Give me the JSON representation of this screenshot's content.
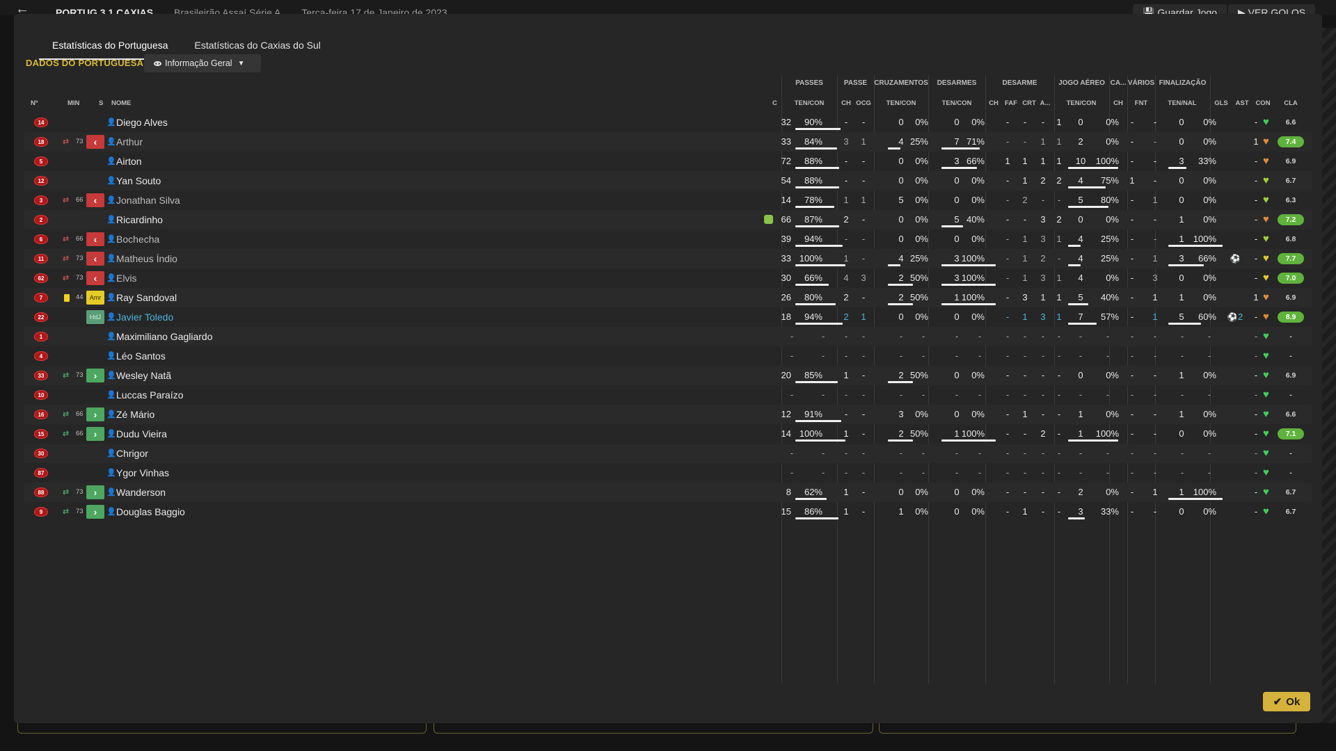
{
  "background": {
    "match_title": "PORTUG 3 1 CAXIAS",
    "competition": "Brasileirão Assaí Série A",
    "date": "Terça-feira 17 de Janeiro de 2023",
    "save_label": "Guardar Jogo",
    "goals_label": "VER GOLOS"
  },
  "tabs": [
    "Estatísticas do Portuguesa",
    "Estatísticas do Caxias do Sul"
  ],
  "section_label": "DADOS DO PORTUGUESA",
  "view_dropdown": "Informação Geral",
  "group_headers": {
    "passes": "PASSES",
    "passe": "PASSE",
    "cruzamentos": "CRUZAMENTOS",
    "desarmes": "DESARMES",
    "desarme": "DESARME",
    "jogo_aereo": "JOGO AÉREO",
    "ca": "CA...",
    "varios": "VÁRIOS",
    "finalizacao": "FINALIZAÇÃO"
  },
  "columns": {
    "num": "Nº",
    "min": "MIN",
    "s": "S",
    "nome": "NOME",
    "c": "C",
    "passes_tc": "TEN/CON",
    "passe_ch": "CH",
    "passe_ocg": "OCG",
    "cruz_tc": "TEN/CON",
    "desarmes_tc": "TEN/CON",
    "desarme_ch": "CH",
    "desarme_faf": "FAF",
    "desarme_crt": "CRT",
    "desarme_a": "A...",
    "aereo_tc": "TEN/CON",
    "ca_ch": "CH",
    "fnt": "FNT",
    "fin_tn": "TEN/NAL",
    "gls": "GLS",
    "ast": "AST",
    "con": "CON",
    "cla": "CLA"
  },
  "players": [
    {
      "num": "14",
      "min": "",
      "s": "",
      "name": "Diego Alves",
      "pa": "32",
      "pp": "90%",
      "pb": 0.9,
      "pch": "-",
      "pocg": "-",
      "ca": "0",
      "cp": "0%",
      "cb": 0,
      "da": "0",
      "dp": "0%",
      "db": 0,
      "dch": "-",
      "dfaf": "-",
      "dcrt": "-",
      "da2": "1",
      "aa": "0",
      "ap": "0%",
      "ab": 0,
      "cach": "-",
      "fnt": "-",
      "fa": "0",
      "fp": "0%",
      "fb": 0,
      "gls": "",
      "ast": "-",
      "con": "green",
      "cla": "6.6"
    },
    {
      "num": "18",
      "min": "73",
      "s": "out",
      "name": "Arthur",
      "pa": "33",
      "pp": "84%",
      "pb": 0.84,
      "pch": "3",
      "pocg": "1",
      "ca": "4",
      "cp": "25%",
      "cb": 0.25,
      "da": "7",
      "dp": "71%",
      "db": 0.71,
      "dch": "-",
      "dfaf": "-",
      "dcrt": "1",
      "da2": "1",
      "aa": "2",
      "ap": "0%",
      "ab": 0,
      "cach": "-",
      "fnt": "-",
      "fa": "0",
      "fp": "0%",
      "fb": 0,
      "gls": "",
      "ast": "1",
      "con": "orange",
      "cla": "7.4"
    },
    {
      "num": "5",
      "min": "",
      "s": "",
      "name": "Airton",
      "pa": "72",
      "pp": "88%",
      "pb": 0.88,
      "pch": "-",
      "pocg": "-",
      "ca": "0",
      "cp": "0%",
      "cb": 0,
      "da": "3",
      "dp": "66%",
      "db": 0.66,
      "dch": "1",
      "dfaf": "1",
      "dcrt": "1",
      "da2": "1",
      "aa": "10",
      "ap": "100%",
      "ab": 1,
      "cach": "-",
      "fnt": "-",
      "fa": "3",
      "fp": "33%",
      "fb": 0.33,
      "gls": "",
      "ast": "-",
      "con": "orange",
      "cla": "6.9"
    },
    {
      "num": "12",
      "min": "",
      "s": "",
      "name": "Yan Souto",
      "pa": "54",
      "pp": "88%",
      "pb": 0.88,
      "pch": "-",
      "pocg": "-",
      "ca": "0",
      "cp": "0%",
      "cb": 0,
      "da": "0",
      "dp": "0%",
      "db": 0,
      "dch": "-",
      "dfaf": "1",
      "dcrt": "2",
      "da2": "2",
      "aa": "4",
      "ap": "75%",
      "ab": 0.75,
      "cach": "1",
      "fnt": "-",
      "fa": "0",
      "fp": "0%",
      "fb": 0,
      "gls": "",
      "ast": "-",
      "con": "lime",
      "cla": "6.7"
    },
    {
      "num": "3",
      "min": "66",
      "s": "out",
      "name": "Jonathan Silva",
      "pa": "14",
      "pp": "78%",
      "pb": 0.78,
      "pch": "1",
      "pocg": "1",
      "ca": "5",
      "cp": "0%",
      "cb": 0,
      "da": "0",
      "dp": "0%",
      "db": 0,
      "dch": "-",
      "dfaf": "2",
      "dcrt": "-",
      "da2": "-",
      "aa": "5",
      "ap": "80%",
      "ab": 0.8,
      "cach": "-",
      "fnt": "1",
      "fa": "0",
      "fp": "0%",
      "fb": 0,
      "gls": "",
      "ast": "-",
      "con": "lime",
      "cla": "6.3"
    },
    {
      "num": "2",
      "min": "",
      "s": "",
      "name": "Ricardinho",
      "pa": "66",
      "pp": "87%",
      "pb": 0.87,
      "pch": "2",
      "pocg": "-",
      "ca": "0",
      "cp": "0%",
      "cb": 0,
      "da": "5",
      "dp": "40%",
      "db": 0.4,
      "dch": "-",
      "dfaf": "-",
      "dcrt": "3",
      "da2": "2",
      "aa": "0",
      "ap": "0%",
      "ab": 0,
      "cach": "-",
      "fnt": "-",
      "fa": "1",
      "fp": "0%",
      "fb": 0,
      "gls": "",
      "ast": "-",
      "con": "orange",
      "cla": "7.2",
      "captain": true
    },
    {
      "num": "6",
      "min": "66",
      "s": "out",
      "name": "Bochecha",
      "pa": "39",
      "pp": "94%",
      "pb": 0.94,
      "pch": "-",
      "pocg": "-",
      "ca": "0",
      "cp": "0%",
      "cb": 0,
      "da": "0",
      "dp": "0%",
      "db": 0,
      "dch": "-",
      "dfaf": "1",
      "dcrt": "3",
      "da2": "1",
      "aa": "4",
      "ap": "25%",
      "ab": 0.25,
      "cach": "-",
      "fnt": "-",
      "fa": "1",
      "fp": "100%",
      "fb": 1,
      "gls": "",
      "ast": "-",
      "con": "lime",
      "cla": "6.8"
    },
    {
      "num": "11",
      "min": "73",
      "s": "out",
      "name": "Matheus Índio",
      "pa": "33",
      "pp": "100%",
      "pb": 1,
      "pch": "1",
      "pocg": "-",
      "ca": "4",
      "cp": "25%",
      "cb": 0.25,
      "da": "3",
      "dp": "100%",
      "db": 1,
      "dch": "-",
      "dfaf": "1",
      "dcrt": "2",
      "da2": "-",
      "aa": "4",
      "ap": "25%",
      "ab": 0.25,
      "cach": "-",
      "fnt": "1",
      "fa": "3",
      "fp": "66%",
      "fb": 0.66,
      "gls": "ball",
      "ast": "-",
      "con": "yellow",
      "cla": "7.7"
    },
    {
      "num": "62",
      "min": "73",
      "s": "out",
      "name": "Elvis",
      "pa": "30",
      "pp": "66%",
      "pb": 0.66,
      "pch": "4",
      "pocg": "3",
      "ca": "2",
      "cp": "50%",
      "cb": 0.5,
      "da": "3",
      "dp": "100%",
      "db": 1,
      "dch": "-",
      "dfaf": "1",
      "dcrt": "3",
      "da2": "1",
      "aa": "4",
      "ap": "0%",
      "ab": 0,
      "cach": "-",
      "fnt": "3",
      "fa": "0",
      "fp": "0%",
      "fb": 0,
      "gls": "",
      "ast": "-",
      "con": "yellow",
      "cla": "7.0"
    },
    {
      "num": "7",
      "min": "44",
      "s": "amr",
      "name": "Ray Sandoval",
      "pa": "26",
      "pp": "80%",
      "pb": 0.8,
      "pch": "2",
      "pocg": "-",
      "ca": "2",
      "cp": "50%",
      "cb": 0.5,
      "da": "1",
      "dp": "100%",
      "db": 1,
      "dch": "-",
      "dfaf": "3",
      "dcrt": "1",
      "da2": "1",
      "aa": "5",
      "ap": "40%",
      "ab": 0.4,
      "cach": "-",
      "fnt": "1",
      "fa": "1",
      "fp": "0%",
      "fb": 0,
      "gls": "",
      "ast": "1",
      "con": "orange",
      "cla": "6.9",
      "yellowcard": true
    },
    {
      "num": "22",
      "min": "",
      "s": "hdj",
      "name": "Javier Toledo",
      "pa": "18",
      "pp": "94%",
      "pb": 0.94,
      "pch": "2",
      "pocg": "1",
      "ca": "0",
      "cp": "0%",
      "cb": 0,
      "da": "0",
      "dp": "0%",
      "db": 0,
      "dch": "-",
      "dfaf": "1",
      "dcrt": "3",
      "da2": "1",
      "aa": "7",
      "ap": "57%",
      "ab": 0.57,
      "cach": "-",
      "fnt": "1",
      "fa": "5",
      "fp": "60%",
      "fb": 0.6,
      "gls": "ball2",
      "ast": "-",
      "con": "orange",
      "cla": "8.9",
      "link": true
    },
    {
      "num": "1",
      "min": "",
      "s": "",
      "name": "Maximiliano Gagliardo",
      "empty": true,
      "con": "green",
      "cla": "-"
    },
    {
      "num": "4",
      "min": "",
      "s": "",
      "name": "Léo Santos",
      "empty": true,
      "con": "green",
      "cla": "-"
    },
    {
      "num": "33",
      "min": "73",
      "s": "in",
      "name": "Wesley Natã",
      "pa": "20",
      "pp": "85%",
      "pb": 0.85,
      "pch": "1",
      "pocg": "-",
      "ca": "2",
      "cp": "50%",
      "cb": 0.5,
      "da": "0",
      "dp": "0%",
      "db": 0,
      "dch": "-",
      "dfaf": "-",
      "dcrt": "-",
      "da2": "-",
      "aa": "0",
      "ap": "0%",
      "ab": 0,
      "cach": "-",
      "fnt": "-",
      "fa": "1",
      "fp": "0%",
      "fb": 0,
      "gls": "",
      "ast": "-",
      "con": "green",
      "cla": "6.9"
    },
    {
      "num": "10",
      "min": "",
      "s": "",
      "name": "Luccas Paraízo",
      "empty": true,
      "con": "green",
      "cla": "-"
    },
    {
      "num": "16",
      "min": "66",
      "s": "in",
      "name": "Zé Mário",
      "pa": "12",
      "pp": "91%",
      "pb": 0.91,
      "pch": "-",
      "pocg": "-",
      "ca": "3",
      "cp": "0%",
      "cb": 0,
      "da": "0",
      "dp": "0%",
      "db": 0,
      "dch": "-",
      "dfaf": "1",
      "dcrt": "-",
      "da2": "-",
      "aa": "1",
      "ap": "0%",
      "ab": 0,
      "cach": "-",
      "fnt": "-",
      "fa": "1",
      "fp": "0%",
      "fb": 0,
      "gls": "",
      "ast": "-",
      "con": "green",
      "cla": "6.6"
    },
    {
      "num": "15",
      "min": "66",
      "s": "in",
      "name": "Dudu Vieira",
      "pa": "14",
      "pp": "100%",
      "pb": 1,
      "pch": "1",
      "pocg": "-",
      "ca": "2",
      "cp": "50%",
      "cb": 0.5,
      "da": "1",
      "dp": "100%",
      "db": 1,
      "dch": "-",
      "dfaf": "-",
      "dcrt": "2",
      "da2": "-",
      "aa": "1",
      "ap": "100%",
      "ab": 1,
      "cach": "-",
      "fnt": "-",
      "fa": "0",
      "fp": "0%",
      "fb": 0,
      "gls": "",
      "ast": "-",
      "con": "green",
      "cla": "7.1"
    },
    {
      "num": "30",
      "min": "",
      "s": "",
      "name": "Chrigor",
      "empty": true,
      "con": "green",
      "cla": "-"
    },
    {
      "num": "87",
      "min": "",
      "s": "",
      "name": "Ygor Vinhas",
      "empty": true,
      "con": "green",
      "cla": "-"
    },
    {
      "num": "88",
      "min": "73",
      "s": "in",
      "name": "Wanderson",
      "pa": "8",
      "pp": "62%",
      "pb": 0.62,
      "pch": "1",
      "pocg": "-",
      "ca": "0",
      "cp": "0%",
      "cb": 0,
      "da": "0",
      "dp": "0%",
      "db": 0,
      "dch": "-",
      "dfaf": "-",
      "dcrt": "-",
      "da2": "-",
      "aa": "2",
      "ap": "0%",
      "ab": 0,
      "cach": "-",
      "fnt": "1",
      "fa": "1",
      "fp": "100%",
      "fb": 1,
      "gls": "",
      "ast": "-",
      "con": "green",
      "cla": "6.7"
    },
    {
      "num": "9",
      "min": "73",
      "s": "in",
      "name": "Douglas Baggio",
      "pa": "15",
      "pp": "86%",
      "pb": 0.86,
      "pch": "1",
      "pocg": "-",
      "ca": "1",
      "cp": "0%",
      "cb": 0,
      "da": "0",
      "dp": "0%",
      "db": 0,
      "dch": "-",
      "dfaf": "1",
      "dcrt": "-",
      "da2": "-",
      "aa": "3",
      "ap": "33%",
      "ab": 0.33,
      "cach": "-",
      "fnt": "-",
      "fa": "0",
      "fp": "0%",
      "fb": 0,
      "gls": "",
      "ast": "-",
      "con": "green",
      "cla": "6.7"
    }
  ],
  "ok_label": "Ok",
  "colors": {
    "accent": "#d4b23c",
    "rating_high": "#5fb33c",
    "sub_out": "#c63a3a",
    "sub_in": "#4da760",
    "link": "#4fb3d9"
  }
}
